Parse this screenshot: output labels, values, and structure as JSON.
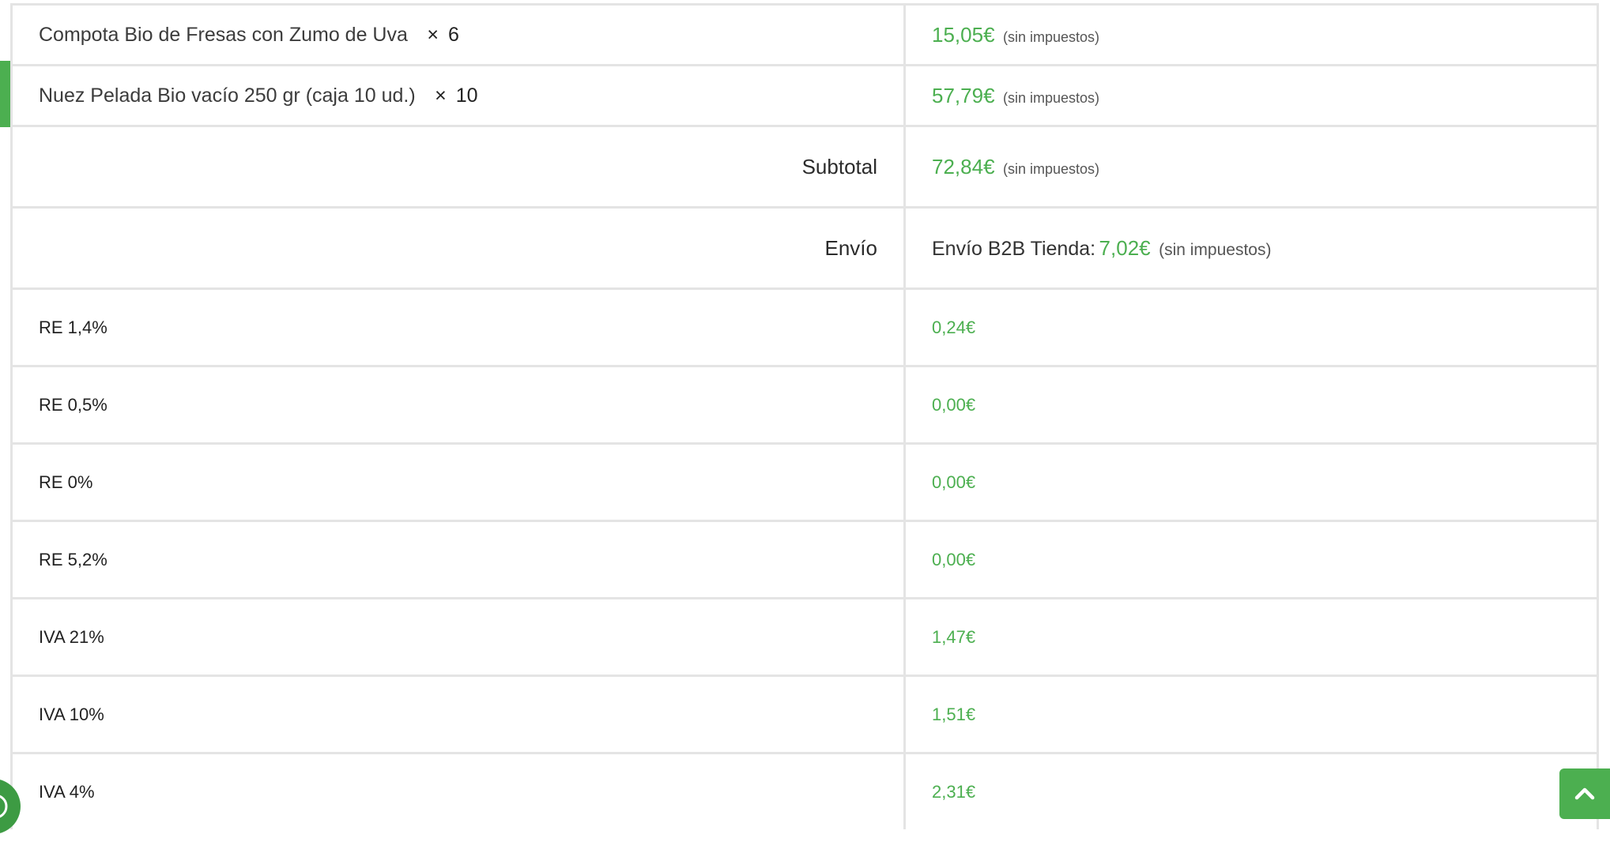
{
  "items": [
    {
      "name": "Compota Bio de Fresas con Zumo de Uva",
      "qty_sign": "×",
      "qty": "6",
      "price": "15,05€",
      "note": "(sin impuestos)"
    },
    {
      "name": "Nuez Pelada Bio vacío 250 gr (caja 10 ud.)",
      "qty_sign": "×",
      "qty": "10",
      "price": "57,79€",
      "note": "(sin impuestos)"
    }
  ],
  "subtotal": {
    "label": "Subtotal",
    "value": "72,84€",
    "note": "(sin impuestos)"
  },
  "shipping": {
    "label": "Envío",
    "method": "Envío B2B Tienda:",
    "value": "7,02€",
    "note": "(sin impuestos)"
  },
  "taxes": [
    {
      "label": "RE 1,4%",
      "value": "0,24€"
    },
    {
      "label": "RE 0,5%",
      "value": "0,00€"
    },
    {
      "label": "RE 0%",
      "value": "0,00€"
    },
    {
      "label": "RE 5,2%",
      "value": "0,00€"
    },
    {
      "label": "IVA 21%",
      "value": "1,47€"
    },
    {
      "label": "IVA 10%",
      "value": "1,51€"
    },
    {
      "label": "IVA 4%",
      "value": "2,31€"
    }
  ],
  "controls": {
    "scroll_top_icon": "chevron-up-icon",
    "chat_icon": "chat-icon"
  },
  "colors": {
    "accent": "#4caf50",
    "border": "#e4e4e4",
    "text": "#2b2b2b"
  }
}
